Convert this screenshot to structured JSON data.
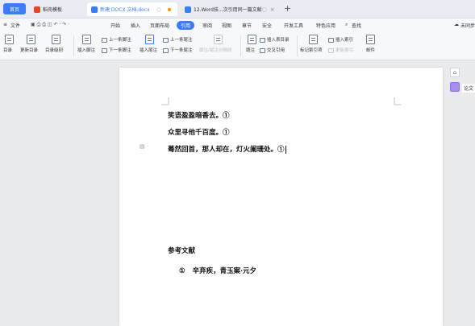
{
  "tabs": {
    "home": "首页",
    "tab1": "稻壳模板",
    "tab2": "新建 DOCX 文档.docx",
    "tab3": "12.Word技...次引用同一篇文献",
    "plus": "+"
  },
  "menu": {
    "file": "文件",
    "items": [
      "开始",
      "插入",
      "页面布局",
      "引用",
      "审阅",
      "视图",
      "章节",
      "安全",
      "开发工具",
      "特色应用"
    ],
    "search": "查找",
    "right": "未同步"
  },
  "ribbon": {
    "toc": "目录",
    "update_toc": "更新目录",
    "toc_level": "目录级别",
    "insert_footnote": "插入脚注",
    "prev_footnote": "上一条脚注",
    "next_footnote": "下一条脚注",
    "insert_endnote": "插入尾注",
    "prev_endnote": "上一条尾注",
    "next_endnote": "下一条尾注",
    "footnote_sep": "脚注/尾注分隔线",
    "caption": "题注",
    "insert_table_toc": "插入表目录",
    "cross_ref": "交叉引用",
    "mark_index": "标记索引项",
    "insert_index": "插入索引",
    "update_index": "更新索引",
    "mail": "邮件"
  },
  "document": {
    "line1": "笑语盈盈暗香去。①",
    "line2": "众里寻他千百度。①",
    "line3": "蓦然回首，那人却在，灯火阑珊处。①",
    "ref_title": "参考文献",
    "ref_num": "①",
    "ref_item": "辛弃疾，青玉案·元夕"
  },
  "right_panel": {
    "paper_label": "论文"
  },
  "colors": {
    "accent": "#3c7cf5",
    "page": "#ffffff",
    "workspace": "#e9eaec"
  }
}
